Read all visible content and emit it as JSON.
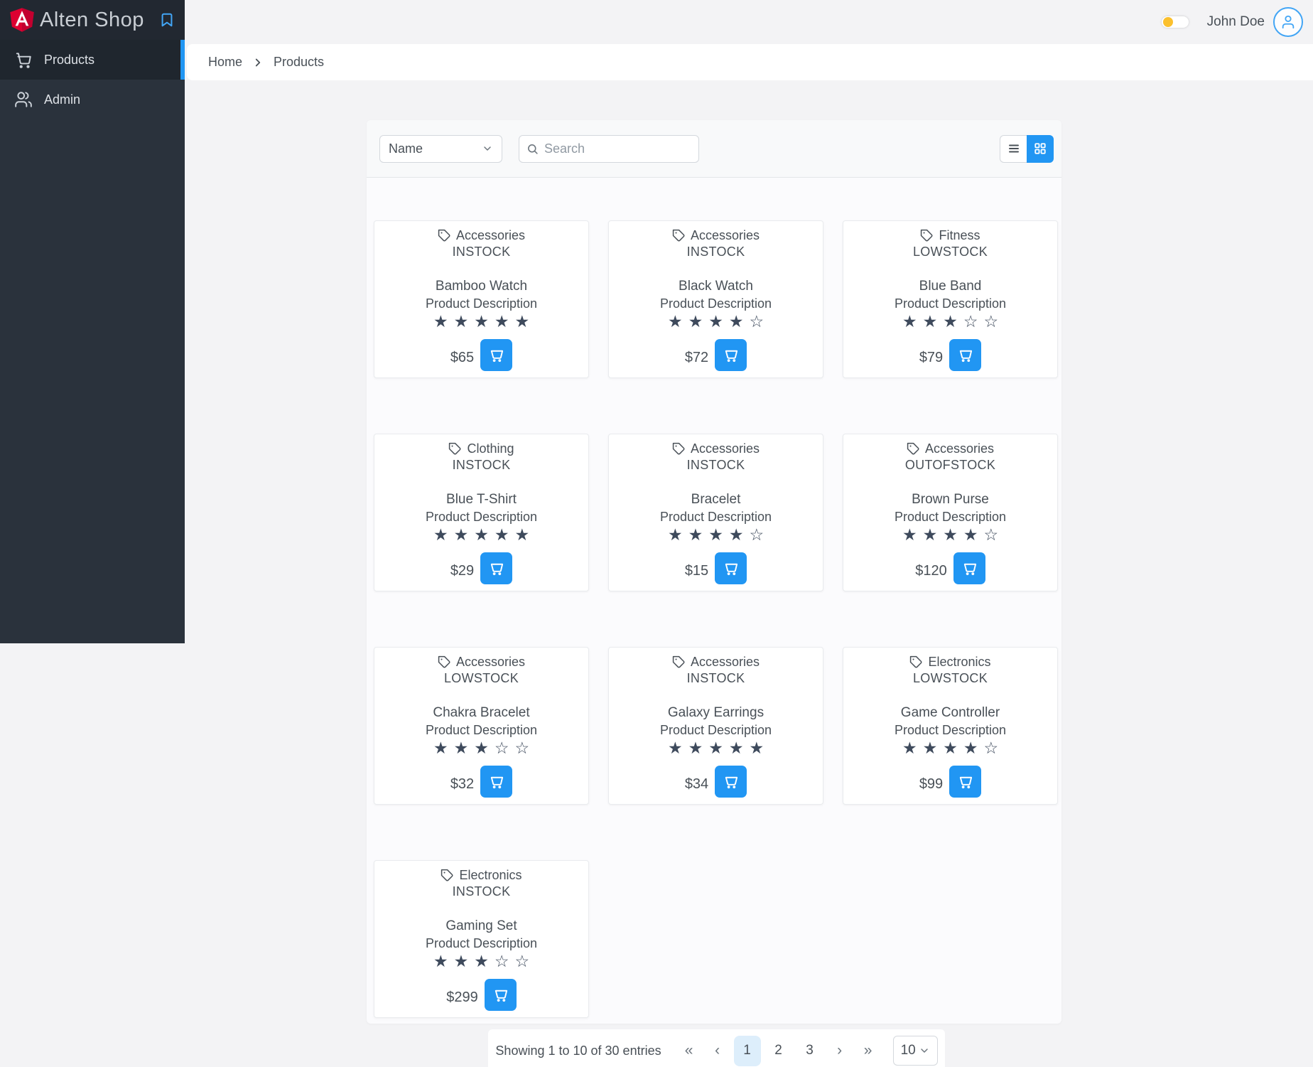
{
  "app": {
    "title": "Alten Shop"
  },
  "topbar": {
    "user_name": "John Doe"
  },
  "sidebar": {
    "items": [
      {
        "label": "Products",
        "icon": "cart-icon",
        "active": true
      },
      {
        "label": "Admin",
        "icon": "users-icon",
        "active": false
      }
    ]
  },
  "breadcrumb": {
    "home": "Home",
    "current": "Products"
  },
  "toolbar": {
    "sort_selected": "Name",
    "search_placeholder": "Search",
    "search_value": ""
  },
  "products": [
    {
      "category": "Accessories",
      "stock_status": "INSTOCK",
      "name": "Bamboo Watch",
      "description": "Product Description",
      "rating": 5,
      "price": "$65"
    },
    {
      "category": "Accessories",
      "stock_status": "INSTOCK",
      "name": "Black Watch",
      "description": "Product Description",
      "rating": 4,
      "price": "$72"
    },
    {
      "category": "Fitness",
      "stock_status": "LOWSTOCK",
      "name": "Blue Band",
      "description": "Product Description",
      "rating": 3,
      "price": "$79"
    },
    {
      "category": "Clothing",
      "stock_status": "INSTOCK",
      "name": "Blue T-Shirt",
      "description": "Product Description",
      "rating": 5,
      "price": "$29"
    },
    {
      "category": "Accessories",
      "stock_status": "INSTOCK",
      "name": "Bracelet",
      "description": "Product Description",
      "rating": 4,
      "price": "$15"
    },
    {
      "category": "Accessories",
      "stock_status": "OUTOFSTOCK",
      "name": "Brown Purse",
      "description": "Product Description",
      "rating": 4,
      "price": "$120"
    },
    {
      "category": "Accessories",
      "stock_status": "LOWSTOCK",
      "name": "Chakra Bracelet",
      "description": "Product Description",
      "rating": 3,
      "price": "$32"
    },
    {
      "category": "Accessories",
      "stock_status": "INSTOCK",
      "name": "Galaxy Earrings",
      "description": "Product Description",
      "rating": 5,
      "price": "$34"
    },
    {
      "category": "Electronics",
      "stock_status": "LOWSTOCK",
      "name": "Game Controller",
      "description": "Product Description",
      "rating": 4,
      "price": "$99"
    },
    {
      "category": "Electronics",
      "stock_status": "INSTOCK",
      "name": "Gaming Set",
      "description": "Product Description",
      "rating": 3,
      "price": "$299"
    }
  ],
  "pagination": {
    "summary": "Showing 1 to 10 of 30 entries",
    "first_label": "«",
    "prev_label": "‹",
    "next_label": "›",
    "last_label": "»",
    "pages": [
      "1",
      "2",
      "3"
    ],
    "current_page": "1",
    "page_size": "10"
  },
  "colors": {
    "accent": "#2196f3",
    "accent_light": "#42a5f5",
    "sidebar_bg": "#2a323c",
    "star": "#3e4a5c",
    "toggle_knob": "#fbc02d",
    "active_page_bg": "#ddeefb"
  }
}
